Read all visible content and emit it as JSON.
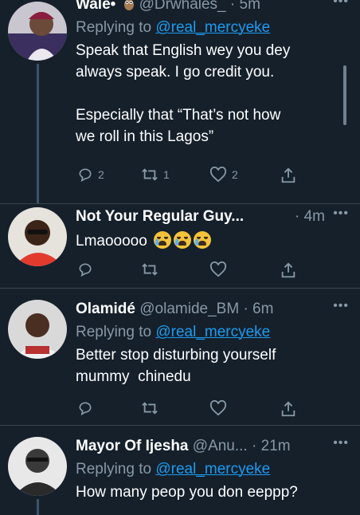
{
  "tweets": [
    {
      "name": "Wale",
      "name_suffix": "•",
      "handle": "@Drwhales_",
      "time": "· 5m",
      "more": "•••",
      "reply_prefix": "Replying to",
      "reply_to": "@real_mercyeke",
      "text_1": "Speak that English wey you dey",
      "text_2": "always speak. I go credit you.",
      "text_3": "Especially that “That’s not how",
      "text_4": "we roll in this Lagos”",
      "replies": "2",
      "retweets": "1",
      "likes": "2"
    },
    {
      "name": "Not Your Regular Guy...",
      "time": "· 4m",
      "more": "•••",
      "text_1": "Lmaooooo"
    },
    {
      "name": "Olamidé",
      "handle": "@olamide_BM",
      "time": "· 6m",
      "more": "•••",
      "reply_prefix": "Replying to",
      "reply_to": "@real_mercyeke",
      "text_1": "Better stop disturbing yourself",
      "text_2": "mummy  chinedu"
    },
    {
      "name": "Mayor Of Ijesha",
      "handle": "@Anu...",
      "time": "· 21m",
      "more": "•••",
      "reply_prefix": "Replying to",
      "reply_to": "@real_mercyeke",
      "text_1": "How many peop you don eeppp?"
    }
  ],
  "colors": {
    "background": "#15202b",
    "text": "#ffffff",
    "muted": "#8899a6",
    "link": "#1d9bf0",
    "divider": "#38444d"
  }
}
